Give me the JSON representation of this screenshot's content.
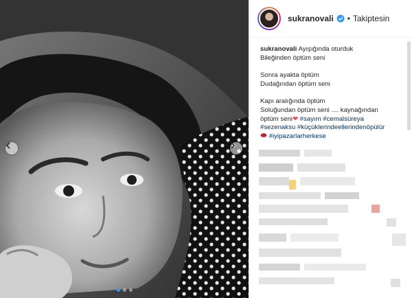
{
  "post": {
    "username": "sukranovali",
    "follow_status": "Takiptesin",
    "separator": "•",
    "caption": {
      "line1": "Ayışığında oturduk",
      "line2": "Bileğinden öptüm seni",
      "line3": "Sonra ayakta öptüm",
      "line4": "Dudağından öptüm seni",
      "line5": "Kapı aralığında öptüm",
      "line6": "Soluğundan öptüm seni .... kaynağından",
      "line7": "öptüm seni",
      "hashtags": [
        "#sayım",
        "#cemalsüreya",
        "#sezenaksu",
        "#küçüklerindeellerindenöpülür",
        "#iyipazarlarherkese"
      ]
    }
  },
  "carousel": {
    "slide_count": 3,
    "active_slide": 1
  },
  "colors": {
    "hashtag": "#003569",
    "verified": "#3897f0",
    "active_dot": "#3897f0",
    "heart": "#ed4956"
  }
}
